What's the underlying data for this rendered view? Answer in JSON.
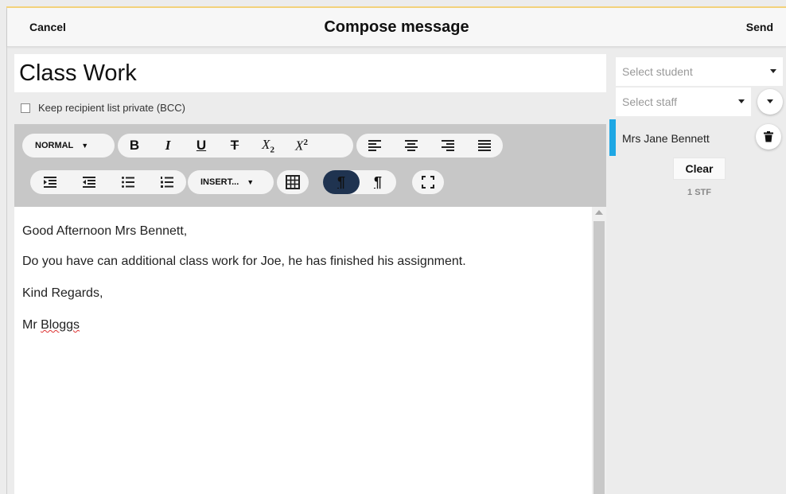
{
  "header": {
    "cancel_label": "Cancel",
    "title": "Compose message",
    "send_label": "Send"
  },
  "compose": {
    "subject": "Class Work",
    "bcc_label": "Keep recipient list private (BCC)",
    "bcc_checked": false
  },
  "toolbar": {
    "format_dropdown": "NORMAL",
    "insert_dropdown": "INSERT...",
    "bold": "B",
    "italic": "I",
    "underline": "U",
    "strikethrough": "T",
    "subscript_base": "X",
    "subscript_mark": "2",
    "superscript_base": "X",
    "superscript_mark": "2",
    "paragraph_mark": "¶"
  },
  "body": {
    "line1": "Good Afternoon Mrs Bennett,",
    "line2": "Do you have can additional class work for Joe, he has finished his assignment.",
    "line3": "Kind Regards,",
    "line4_prefix": "Mr ",
    "line4_name": "Bloggs"
  },
  "recipients": {
    "student_placeholder": "Select student",
    "staff_placeholder": "Select staff",
    "selected": [
      {
        "name": "Mrs Jane Bennett",
        "accent": "#1ea7e4"
      }
    ],
    "clear_label": "Clear",
    "count_label": "1 STF"
  },
  "theme": {
    "accent_blue": "#1ea7e4",
    "toggle_active": "#1f3350"
  }
}
